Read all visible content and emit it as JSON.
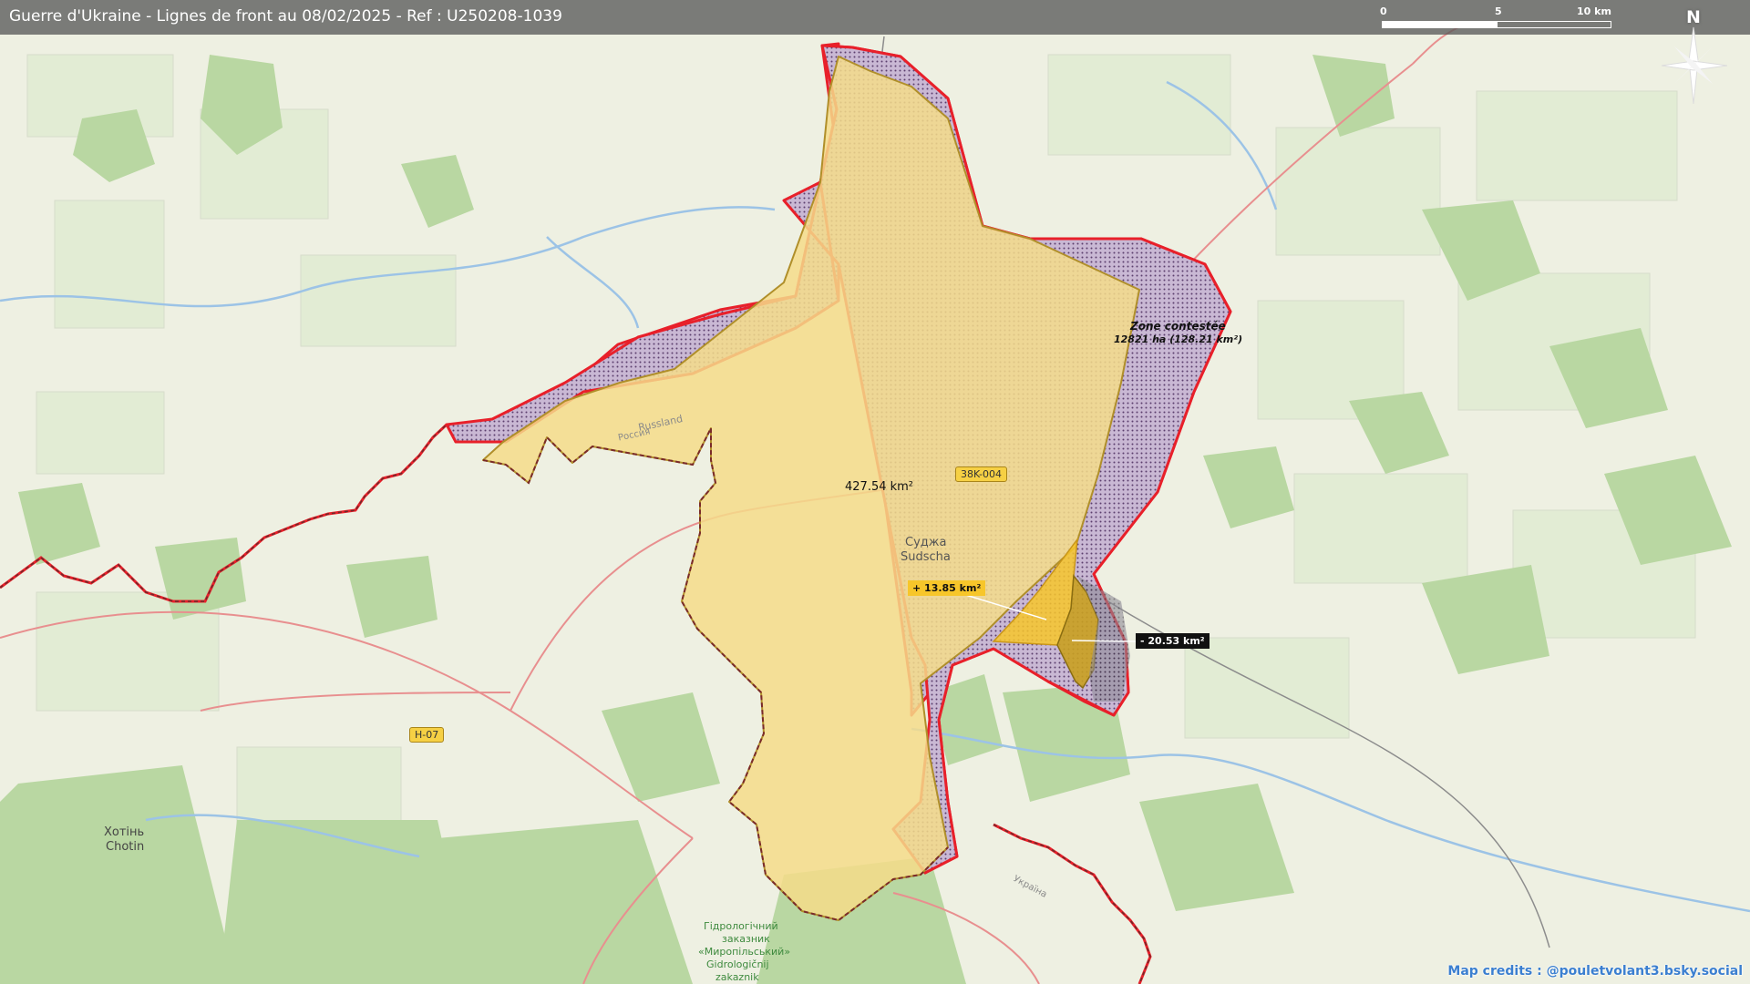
{
  "header": {
    "title": "Guerre d'Ukraine - Lignes de front au 08/02/2025 - Ref : U250208-1039"
  },
  "scale_bar": {
    "labels": [
      "0",
      "5",
      "10 km"
    ]
  },
  "north_arrow": {
    "letter": "N"
  },
  "areas": {
    "controlled_area": "427.54 km²",
    "contested_title": "Zone contestée",
    "contested_value": "12821 ha (128.21 km²)",
    "gain_badge": "+ 13.85 km²",
    "loss_badge": "- 20.53 km²"
  },
  "places": {
    "sudzha_ru": "Суджа",
    "sudzha_de": "Sudscha",
    "russland": "Russland",
    "rossiya": "Россия",
    "ukraina": "Україна",
    "khotin_ua": "Хотінь",
    "khotin_lat": "Chotin",
    "reserve_1": "Гідрологічний",
    "reserve_2": "заказник",
    "reserve_3": "«Миропільський»",
    "reserve_4": "Gidrologičnij",
    "reserve_5": "zakaznik"
  },
  "roads": {
    "r1": "38K-004",
    "r2": "H-07"
  },
  "credits": "Map credits : @pouletvolant3.bsky.social",
  "colors": {
    "controlled_fill": "#f5dc8a",
    "contested_fill": "#b8a4c4",
    "front_line": "#e8202a",
    "gain": "#f7c62a",
    "loss": "#c9a020",
    "forest": "#b9d7a2",
    "water": "#9cc3e6",
    "title_bar": "#5a5a5a"
  }
}
